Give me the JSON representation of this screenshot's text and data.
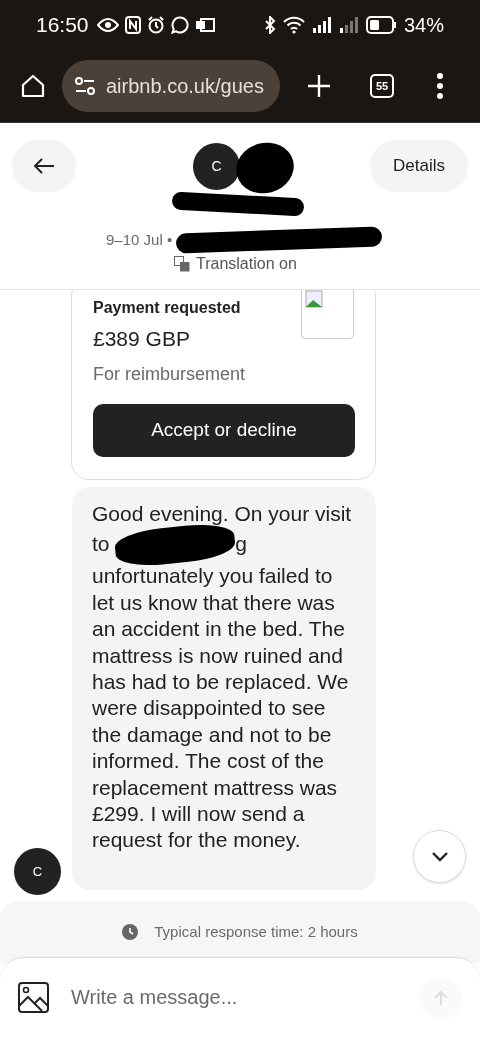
{
  "status_bar": {
    "time": "16:50",
    "battery": "34%"
  },
  "browser": {
    "url": "airbnb.co.uk/gues",
    "tab_count": "55"
  },
  "header": {
    "avatar_initial": "C",
    "dates": "9–10 Jul •",
    "translation": "Translation on",
    "details_button": "Details"
  },
  "payment_card": {
    "title": "Payment requested",
    "amount": "£389 GBP",
    "note": "For reimbursement",
    "button": "Accept or decline"
  },
  "message": {
    "avatar_initial": "C",
    "text_before": "Good evening. On your visit to",
    "text_after": "g unfortunately you failed to let us know that there was an accident in the bed. The mattress is now ruined and has had to be replaced. We were disappointed to see the damage and not to be informed. The cost of the replacement mattress was £299. I will now send a request for the money."
  },
  "response_time": "Typical response time: 2 hours",
  "composer": {
    "placeholder": "Write a message..."
  }
}
